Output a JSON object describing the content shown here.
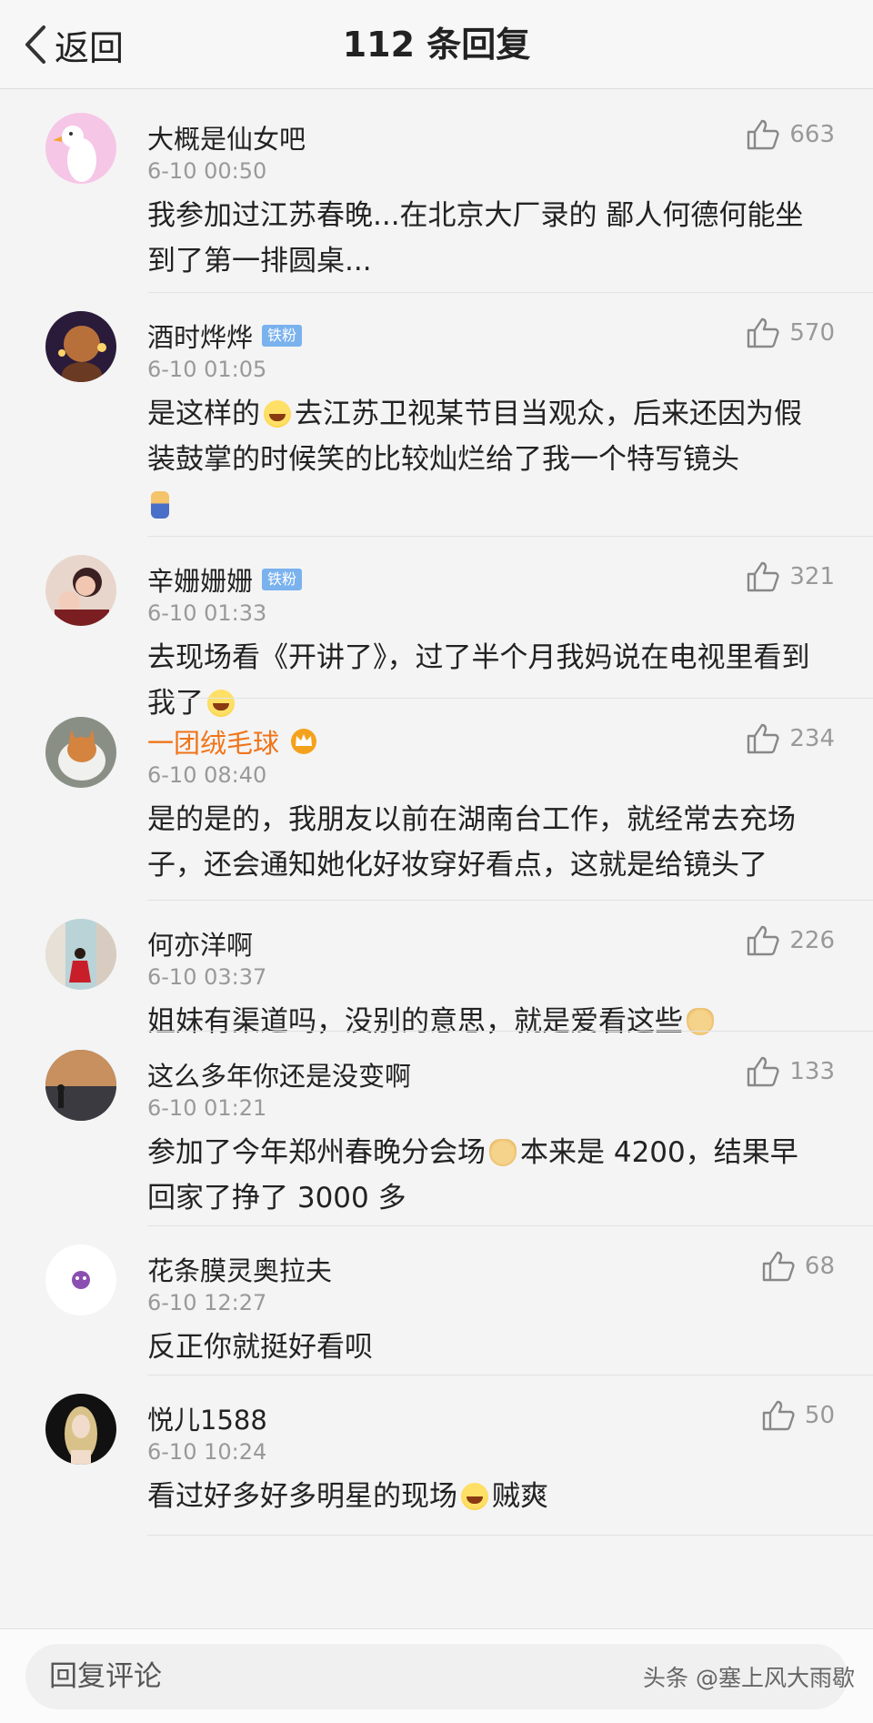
{
  "header": {
    "back_label": "返回",
    "title": "112 条回复"
  },
  "comments": [
    {
      "name": "大概是仙女吧",
      "time": "6-10 00:50",
      "likes": "663",
      "text": "我参加过江苏春晚...在北京大厂录的 鄙人何德何能坐到了第一排圆桌..."
    },
    {
      "name": "酒时烨烨",
      "badge": "铁粉",
      "time": "6-10 01:05",
      "likes": "570",
      "text_a": "是这样的",
      "text_b": "去江苏卫视某节目当观众，后来还因为假装鼓掌的时候笑的比较灿烂给了我一个特写镜头"
    },
    {
      "name": "辛姗姗姗",
      "badge": "铁粉",
      "time": "6-10 01:33",
      "likes": "321",
      "text_a": "去现场看《开讲了》，过了半个月我妈说在电视里看到我了"
    },
    {
      "name": "一团绒毛球",
      "time": "6-10 08:40",
      "likes": "234",
      "text": "是的是的，我朋友以前在湖南台工作，就经常去充场子，还会通知她化好妆穿好看点，这就是给镜头了"
    },
    {
      "name": "何亦洋啊",
      "time": "6-10 03:37",
      "likes": "226",
      "text_a": "姐妹有渠道吗，没别的意思，就是爱看这些"
    },
    {
      "name": "这么多年你还是没变啊",
      "time": "6-10 01:21",
      "likes": "133",
      "text_a": "参加了今年郑州春晚分会场",
      "text_b": "本来是 4200，结果早回家了挣了 3000 多"
    },
    {
      "name": "花条膜灵奥拉夫",
      "time": "6-10 12:27",
      "likes": "68",
      "text": "反正你就挺好看呗"
    },
    {
      "name": "悦儿1588",
      "time": "6-10 10:24",
      "likes": "50",
      "text_a": "看过好多好多明星的现场",
      "text_b": "贼爽"
    }
  ],
  "footer": {
    "reply_placeholder": "回复评论",
    "watermark": "头条 @塞上风大雨歇"
  },
  "colors": {
    "vip_name": "#f07419",
    "badge_bg": "#7ab2ee",
    "meta_gray": "#999999"
  }
}
